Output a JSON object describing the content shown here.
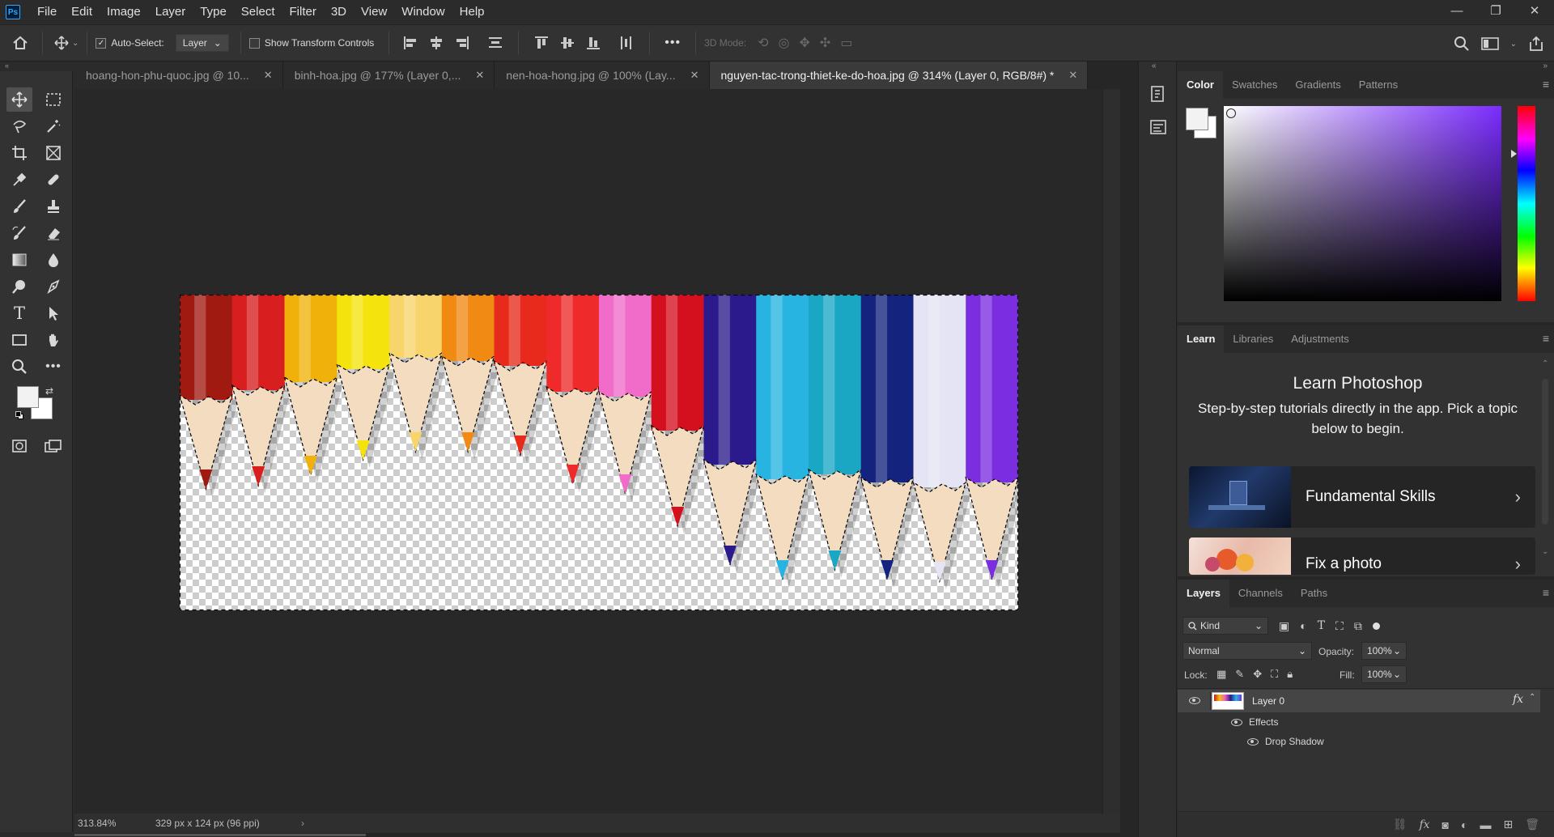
{
  "app": {
    "logo": "Ps"
  },
  "menu": [
    "File",
    "Edit",
    "Image",
    "Layer",
    "Type",
    "Select",
    "Filter",
    "3D",
    "View",
    "Window",
    "Help"
  ],
  "window_controls": {
    "minimize": "—",
    "restore": "❐",
    "close": "✕"
  },
  "options": {
    "auto_select_label": "Auto-Select:",
    "auto_select_checked": true,
    "auto_select_target": "Layer",
    "transform_label": "Show Transform Controls",
    "more": "•••",
    "mode_3d_label": "3D Mode:"
  },
  "tabs": [
    {
      "label": "hoang-hon-phu-quoc.jpg @ 10...",
      "active": false
    },
    {
      "label": "binh-hoa.jpg @ 177% (Layer 0,...",
      "active": false
    },
    {
      "label": "nen-hoa-hong.jpg @ 100% (Lay...",
      "active": false
    },
    {
      "label": "nguyen-tac-trong-thiet-ke-do-hoa.jpg @ 314% (Layer 0, RGB/8#) *",
      "active": true
    }
  ],
  "status": {
    "zoom": "313.84%",
    "doc_size": "329 px x 124 px (96 ppi)",
    "arrow": "›"
  },
  "pencil_colors": [
    "#a11a12",
    "#d81e1e",
    "#f0b20a",
    "#f4e30c",
    "#f7d56a",
    "#f08a12",
    "#e82a1c",
    "#ee2a2a",
    "#f06cc8",
    "#d5101e",
    "#2b1a8c",
    "#27b4e0",
    "#1aa7c4",
    "#13237e",
    "#e4e4f4",
    "#7a2ee0"
  ],
  "color_panel": {
    "tabs": [
      "Color",
      "Swatches",
      "Gradients",
      "Patterns"
    ],
    "active_tab": "Color",
    "hue_color": "#7b2cff",
    "foreground": "#f2f2f2",
    "background": "#ffffff"
  },
  "learn_panel": {
    "tabs": [
      "Learn",
      "Libraries",
      "Adjustments"
    ],
    "active_tab": "Learn",
    "title": "Learn Photoshop",
    "subtitle": "Step-by-step tutorials directly in the app. Pick a topic below to begin.",
    "cards": [
      {
        "title": "Fundamental Skills",
        "arrow": "›"
      },
      {
        "title": "Fix a photo",
        "arrow": "›"
      }
    ]
  },
  "layers_panel": {
    "tabs": [
      "Layers",
      "Channels",
      "Paths"
    ],
    "active_tab": "Layers",
    "filter_label": "Kind",
    "blend_mode": "Normal",
    "opacity_label": "Opacity:",
    "opacity_value": "100%",
    "lock_label": "Lock:",
    "fill_label": "Fill:",
    "fill_value": "100%",
    "layer_name": "Layer 0",
    "fx": "fx",
    "effects_label": "Effects",
    "effect_name": "Drop Shadow"
  }
}
